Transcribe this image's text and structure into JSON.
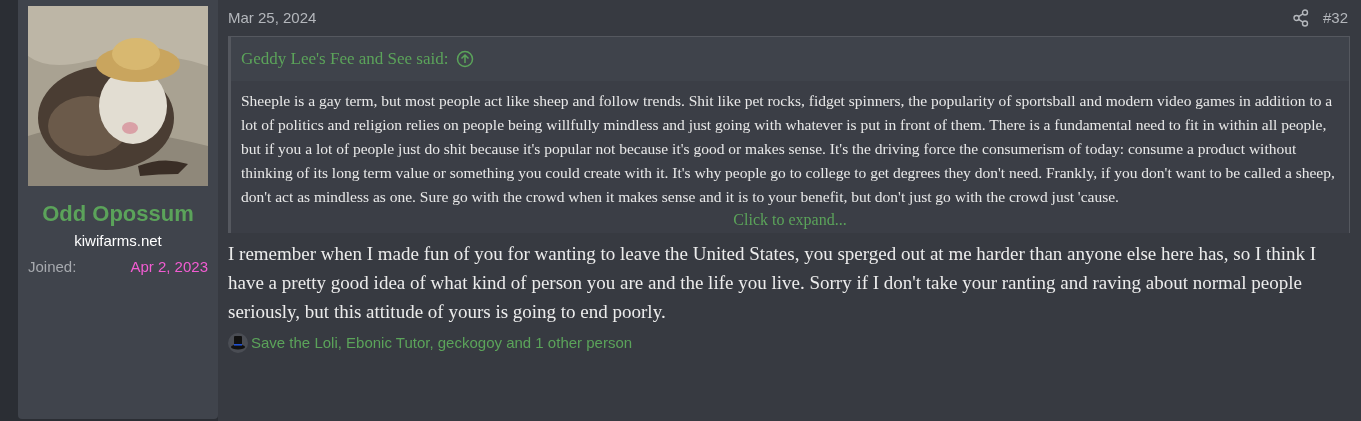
{
  "post": {
    "date": "Mar 25, 2024",
    "number": "#32"
  },
  "user": {
    "name": "Odd Opossum",
    "site": "kiwifarms.net",
    "joined_label": "Joined:",
    "joined_value": "Apr 2, 2023"
  },
  "quote": {
    "author": "Geddy Lee's Fee and See said:",
    "text": "Sheeple is a gay term, but most people act like sheep and follow trends. Shit like pet rocks, fidget spinners, the popularity of sportsball and modern video games in addition to a lot of politics and religion relies on people being willfully mindless and just going with whatever is put in front of them. There is a fundamental need to fit in within all people, but if you a lot of people just do shit because it's popular not because it's good or makes sense. It's the driving force the consumerism of today: consume a product without thinking of its long term value or something you could create with it. It's why people go to college to get degrees they don't need. Frankly, if you don't want to be called a sheep, don't act as mindless as one. Sure go with the crowd when it makes sense and it is to your benefit, but don't just go with the crowd just 'cause.",
    "expand": "Click to expand..."
  },
  "body": "I remember when I made fun of you for wanting to leave the United States, you sperged out at me harder than anyone else here has, so I think I have a pretty good idea of what kind of person you are and the life you live. Sorry if I don't take your ranting and raving about normal people seriously, but this attitude of yours is going to end poorly.",
  "reactions": "Save the Loli, Ebonic Tutor, geckogoy and 1 other person"
}
